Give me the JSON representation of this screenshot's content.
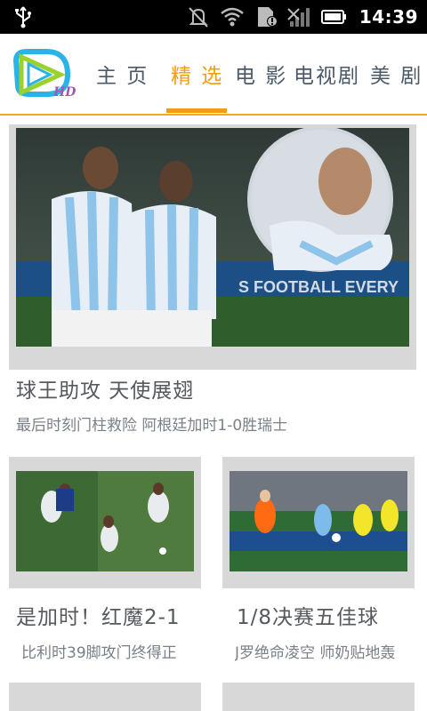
{
  "status_bar": {
    "time": "14:39",
    "icons": [
      "usb-icon",
      "mute-icon",
      "wifi-icon",
      "sim-alert-icon",
      "signal-icon",
      "battery-icon"
    ]
  },
  "header": {
    "logo_text": "HD",
    "tabs": [
      {
        "label": "主 页",
        "active": false
      },
      {
        "label": "精 选",
        "active": true
      },
      {
        "label": "电 影",
        "active": false
      },
      {
        "label": "电视剧",
        "active": false
      },
      {
        "label": "美 剧",
        "active": false
      }
    ]
  },
  "hero": {
    "title": "球王助攻 天使展翅",
    "subtitle": "最后时刻门柱救险 阿根廷加时1-0胜瑞士",
    "banner_text": "S FOOTBALL EVERY"
  },
  "cards": [
    {
      "title": "是加时！红魔2-1",
      "subtitle": "比利时39脚攻门终得正"
    },
    {
      "title": "1/8决赛五佳球",
      "subtitle": "J罗绝命凌空 师奶贴地轰"
    }
  ],
  "colors": {
    "accent": "#f39c12",
    "tab_text": "#4a5a68",
    "card_bg": "#d8d8d8"
  }
}
